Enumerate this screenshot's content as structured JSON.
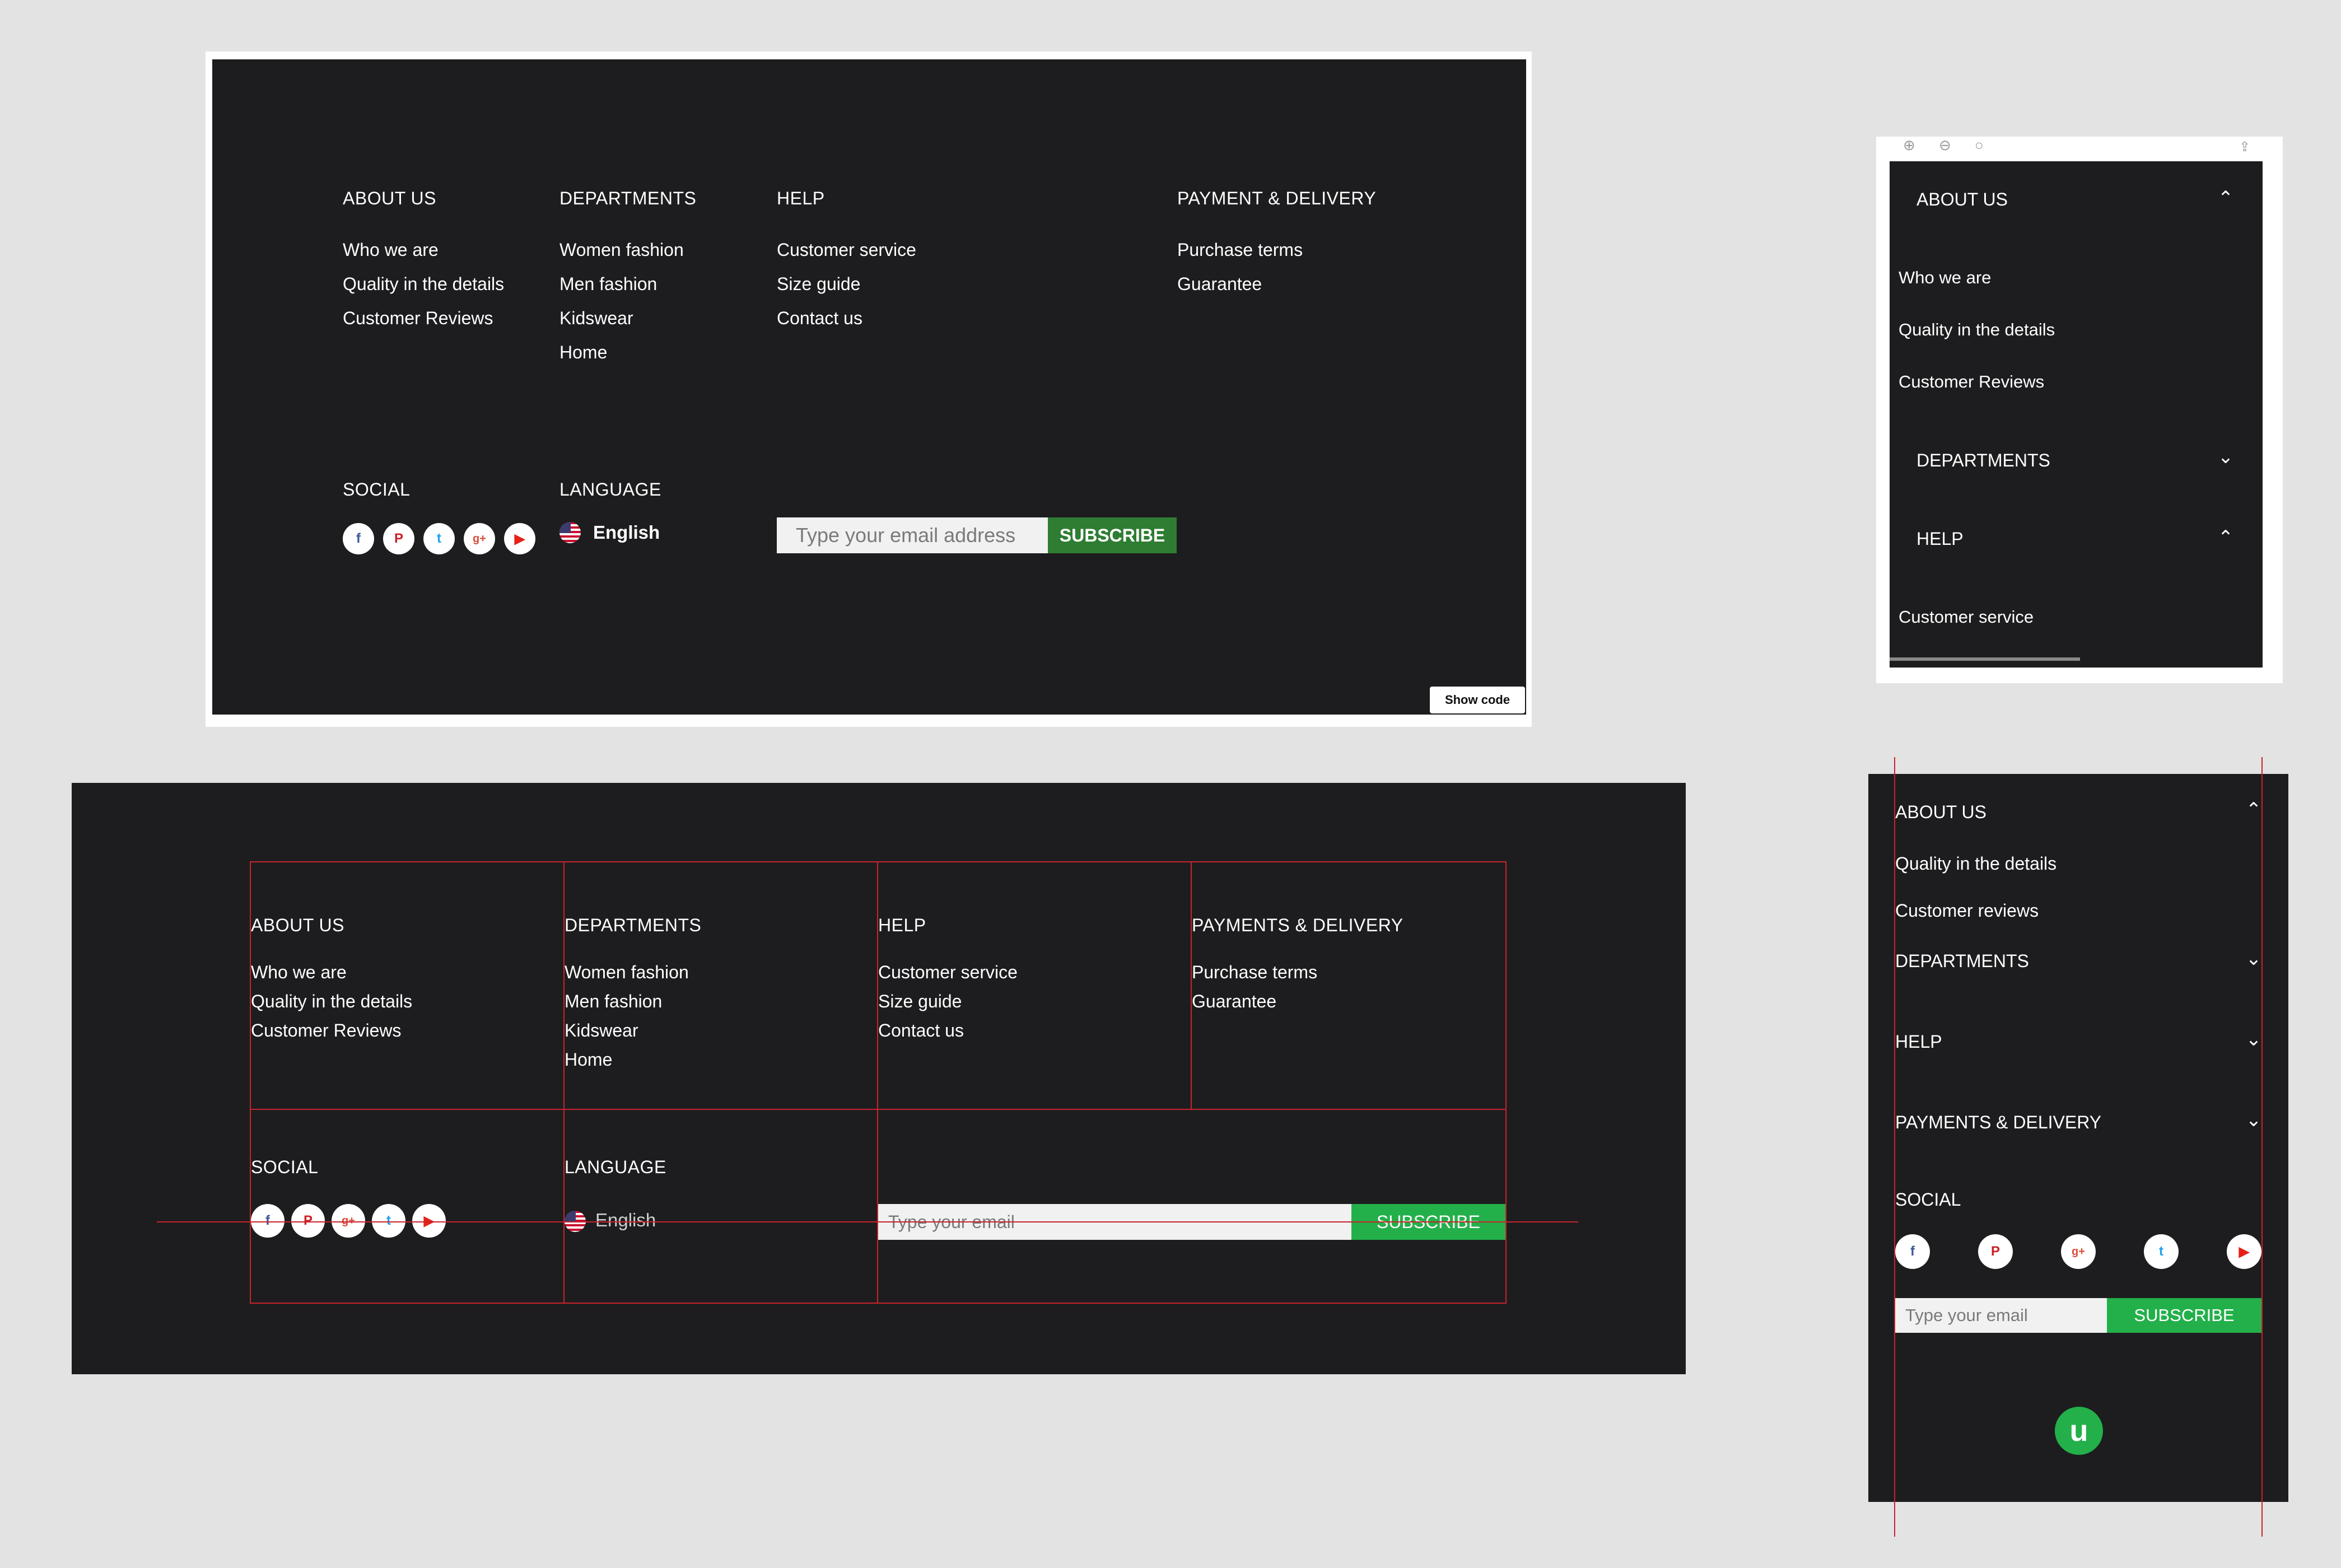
{
  "colors": {
    "background": "#e3e3e3",
    "footer": "#1d1d1f",
    "subscribe_dark_green": "#2e7d32",
    "subscribe_bright_green": "#23b04a",
    "guide_red": "#c8232c"
  },
  "desktop_footer": {
    "columns": [
      {
        "heading": "ABOUT US",
        "links": [
          "Who we are",
          "Quality in the details",
          "Customer Reviews"
        ]
      },
      {
        "heading": "DEPARTMENTS",
        "links": [
          "Women fashion",
          "Men fashion",
          "Kidswear",
          "Home"
        ]
      },
      {
        "heading": "HELP",
        "links": [
          "Customer service",
          "Size guide",
          "Contact us"
        ]
      },
      {
        "heading": "PAYMENT & DELIVERY",
        "links": [
          "Purchase terms",
          "Guarantee"
        ]
      }
    ],
    "social_heading": "SOCIAL",
    "social_icons": [
      "facebook-icon",
      "pinterest-icon",
      "twitter-icon",
      "google-plus-icon",
      "youtube-icon"
    ],
    "language_heading": "LANGUAGE",
    "language_value": "English",
    "email_placeholder": "Type your email address",
    "subscribe_label": "SUBSCRIBE",
    "show_code_label": "Show code"
  },
  "mobile_preview": {
    "toolbar_icons": [
      "zoom-in-icon",
      "zoom-out-icon",
      "search-icon",
      "share-icon"
    ],
    "about_heading": "ABOUT US",
    "about_links": [
      "Who we are",
      "Quality in the details",
      "Customer Reviews"
    ],
    "departments_heading": "DEPARTMENTS",
    "help_heading": "HELP",
    "help_links": [
      "Customer service"
    ]
  },
  "wireframe_footer": {
    "columns": [
      {
        "heading": "ABOUT US",
        "links": [
          "Who we are",
          "Quality in the details",
          "Customer Reviews"
        ]
      },
      {
        "heading": "DEPARTMENTS",
        "links": [
          "Women fashion",
          "Men fashion",
          "Kidswear",
          "Home"
        ]
      },
      {
        "heading": "HELP",
        "links": [
          "Customer service",
          "Size guide",
          "Contact us"
        ]
      },
      {
        "heading": "PAYMENTS & DELIVERY",
        "links": [
          "Purchase terms",
          "Guarantee"
        ]
      }
    ],
    "social_heading": "SOCIAL",
    "language_heading": "LANGUAGE",
    "language_value": "English",
    "email_placeholder": "Type your email",
    "subscribe_label": "SUBSCRIBE"
  },
  "mobile_wireframe": {
    "about_heading": "ABOUT US",
    "about_links": [
      "Quality in the details",
      "Customer reviews"
    ],
    "departments_heading": "DEPARTMENTS",
    "help_heading": "HELP",
    "payments_heading": "PAYMENTS & DELIVERY",
    "social_heading": "SOCIAL",
    "email_placeholder": "Type your email",
    "subscribe_label": "SUBSCRIBE",
    "logo_letter": "u"
  }
}
